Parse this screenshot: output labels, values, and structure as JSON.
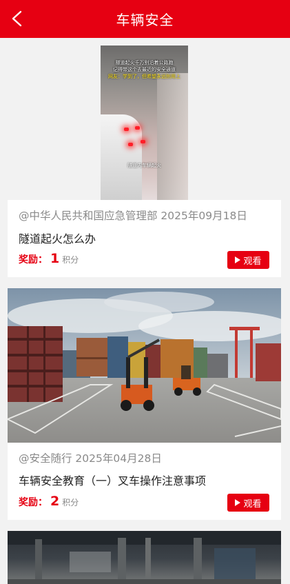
{
  "header": {
    "title": "车辆安全"
  },
  "icons": {
    "back": "back-arrow-icon",
    "play": "play-icon"
  },
  "colors": {
    "brand": "#e60012",
    "meta_text": "#8a8a8a"
  },
  "videos": [
    {
      "thumb_captions": [
        "隧道起火千万别沿着公路跑",
        "记得带这个去最近的安全通道",
        "网友：学到了，但希望永远别用上",
        "隧道内车辆起火"
      ],
      "meta": "@中华人民共和国应急管理部 2025年09月18日",
      "title": "隧道起火怎么办",
      "reward_label": "奖励：",
      "reward_value": "1",
      "reward_unit": "积分",
      "watch_label": "观看"
    },
    {
      "meta": "@安全随行 2025年04月28日",
      "title": "车辆安全教育（一）叉车操作注意事项",
      "reward_label": "奖励：",
      "reward_value": "2",
      "reward_unit": "积分",
      "watch_label": "观看"
    }
  ]
}
